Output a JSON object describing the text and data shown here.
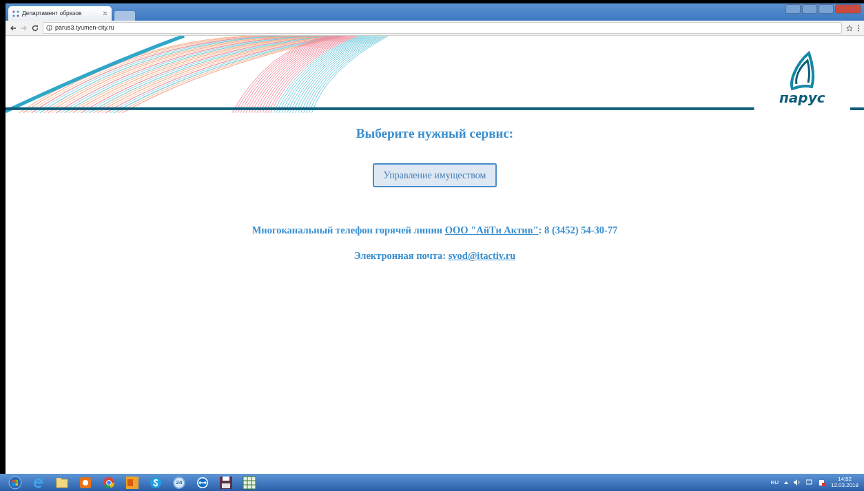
{
  "browser": {
    "tab_title": "Департамент образов",
    "url": "parus3.tyumen-city.ru"
  },
  "logo": {
    "text": "парус"
  },
  "heading": "Выберите нужный сервис:",
  "services": [
    {
      "label": "Управление имуществом"
    }
  ],
  "contacts": [
    {
      "prefix": "Многоканальный телефон горячей линии ",
      "link": "ООО \"АйТи Актив\"",
      "suffix": ": 8 (3452) 54-30-77"
    },
    {
      "prefix": "Электронная почта: ",
      "link": "svod@itactiv.ru"
    }
  ],
  "taskbar": {
    "apps": [
      {
        "kind": "start"
      },
      {
        "kind": "ie"
      },
      {
        "kind": "folder"
      },
      {
        "kind": "media"
      },
      {
        "kind": "chrome"
      },
      {
        "kind": "outlook"
      },
      {
        "kind": "skype"
      },
      {
        "kind": "badge",
        "label": "24"
      },
      {
        "kind": "teamviewer"
      },
      {
        "kind": "disk"
      },
      {
        "kind": "excel"
      }
    ],
    "language": "RU",
    "time": "14:52",
    "date": "12.03.2018"
  }
}
